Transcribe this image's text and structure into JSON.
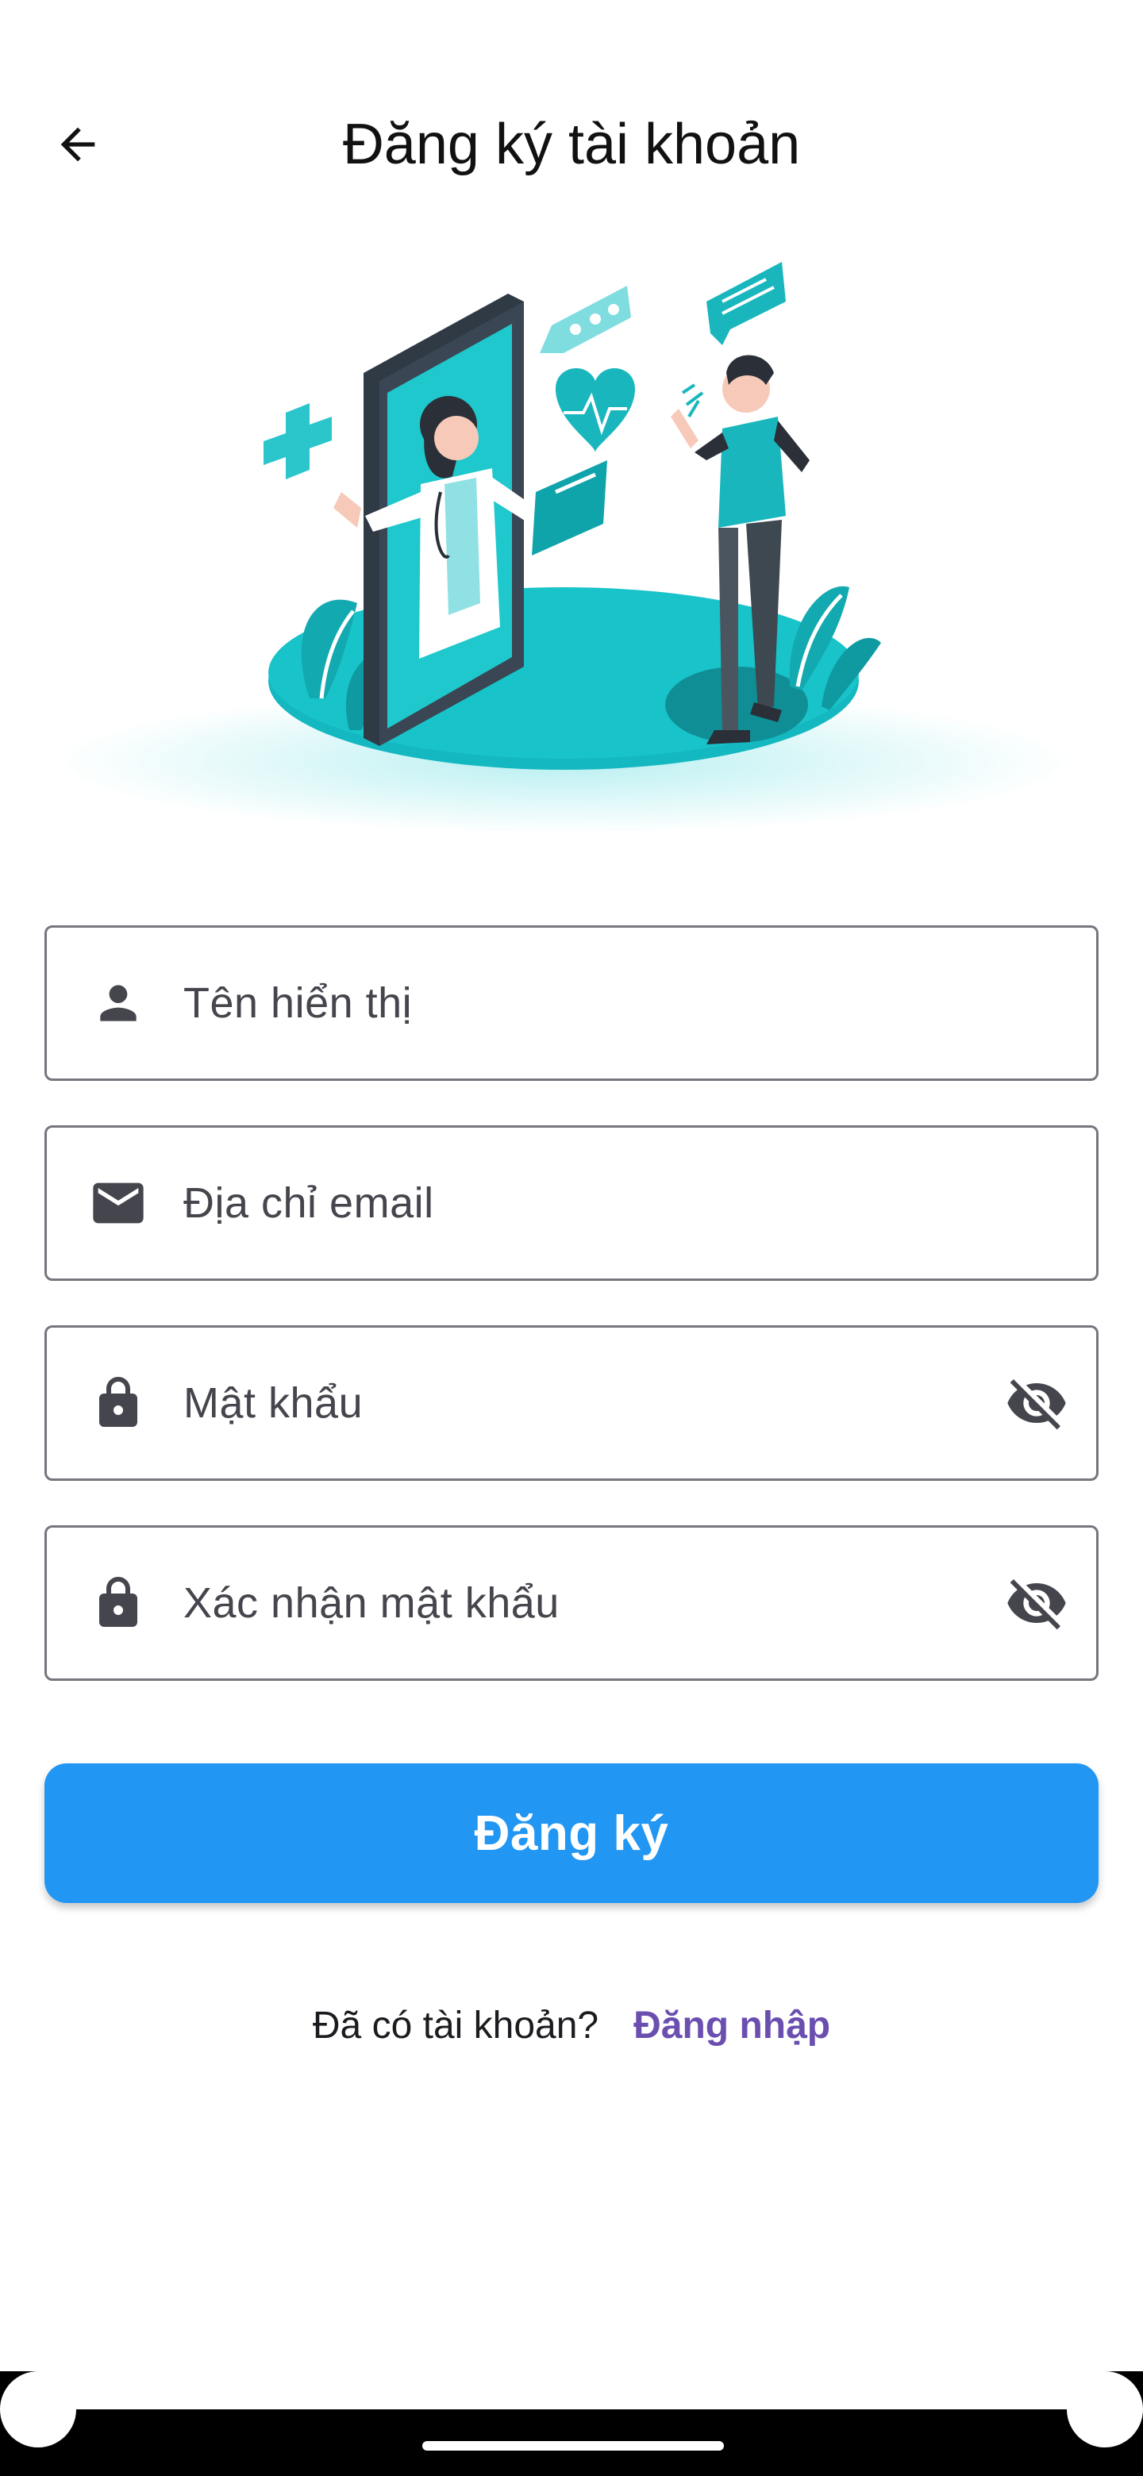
{
  "header": {
    "title": "Đăng ký tài khoản",
    "back_icon": "arrow-back-icon"
  },
  "illustration": {
    "icon": "telemedicine-doctor-illustration",
    "accent_color": "#14b8c0"
  },
  "form": {
    "fields": [
      {
        "placeholder": "Tên hiển thị",
        "icon": "person-icon"
      },
      {
        "placeholder": "Địa chỉ email",
        "icon": "mail-icon"
      },
      {
        "placeholder": "Mật khẩu",
        "icon": "lock-icon",
        "trailing_icon": "visibility-off-icon"
      },
      {
        "placeholder": "Xác nhận mật khẩu",
        "icon": "lock-icon",
        "trailing_icon": "visibility-off-icon"
      }
    ],
    "submit_label": "Đăng ký"
  },
  "footer": {
    "question": "Đã có tài khoản?",
    "login_link": "Đăng nhập"
  },
  "colors": {
    "primary": "#2196f3",
    "link": "#6a4fb0",
    "field_border": "#79747e",
    "icon": "#45454d"
  }
}
